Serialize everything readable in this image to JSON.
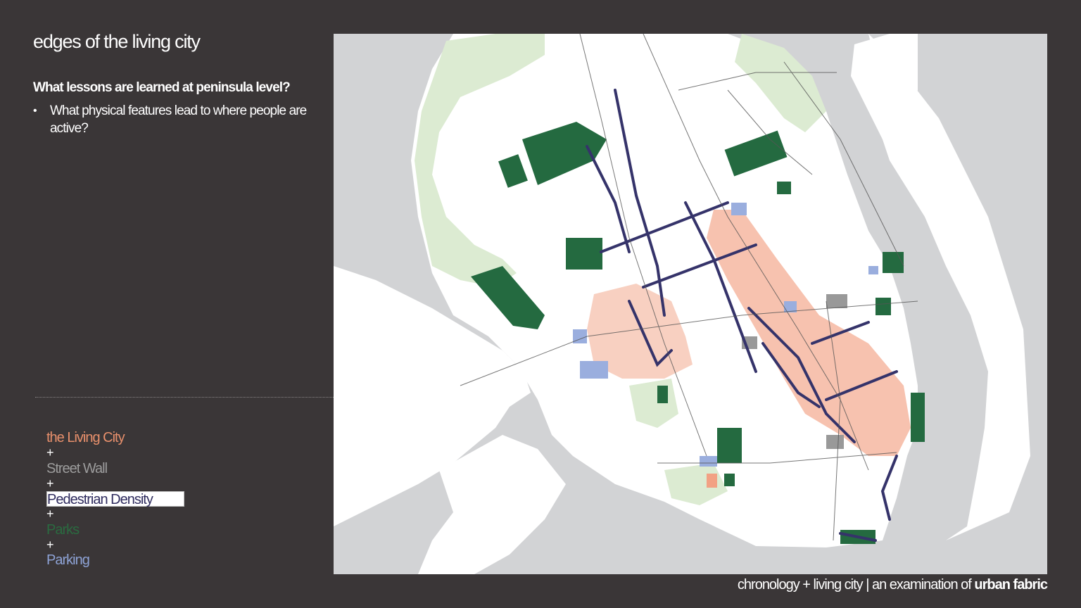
{
  "slide": {
    "title": "edges of the living city",
    "question": "What lessons are learned at peninsula level?",
    "bullet_marker": "•",
    "bullet": "What physical features lead to where people are active?"
  },
  "legend": {
    "living_city": "the Living City",
    "plus": "+",
    "street_wall": "Street Wall",
    "pedestrian_density": "Pedestrian Density",
    "parks": "Parks",
    "parking": "Parking"
  },
  "colors": {
    "background": "#3a3637",
    "water": "#d2d3d5",
    "land": "#ffffff",
    "green_space": "#dcebd2",
    "parks": "#246a40",
    "parking": "#9aaede",
    "street_wall": "#999999",
    "pedestrian_density": "#35336a",
    "living_city": "#f2a184"
  },
  "footer": {
    "main": "chronology + living city | an examination of ",
    "bold": "urban fabric"
  }
}
